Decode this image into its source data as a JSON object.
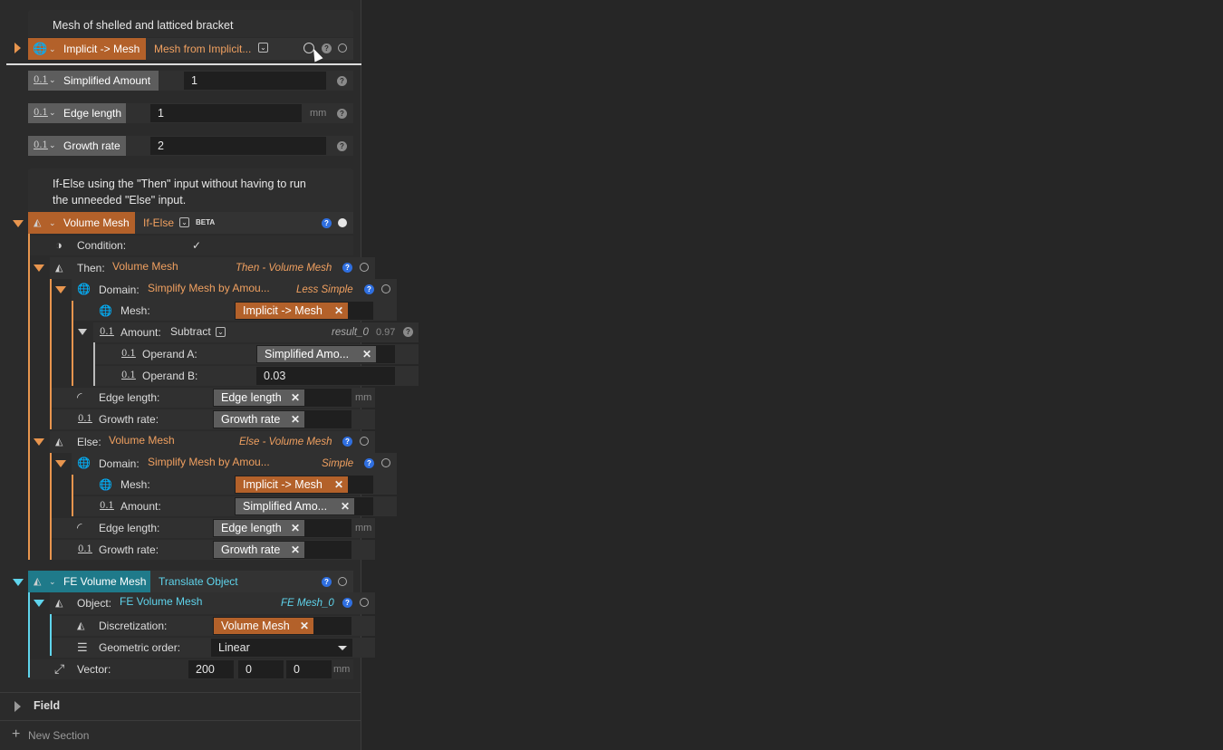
{
  "note1": {
    "text": "Mesh of shelled and latticed bracket"
  },
  "implicit_mesh": {
    "tag": "Implicit -> Mesh",
    "title": "Mesh from Implicit..."
  },
  "simplified_amount": {
    "label": "Simplified Amount",
    "value": "1"
  },
  "edge_length": {
    "label": "Edge length",
    "value": "1",
    "unit": "mm"
  },
  "growth_rate": {
    "label": "Growth rate",
    "value": "2"
  },
  "note2": {
    "line1": "If-Else using the \"Then\" input without having to run",
    "line2": "the unneeded \"Else\" input."
  },
  "volume_mesh": {
    "tag": "Volume Mesh",
    "title": "If-Else",
    "beta": "BETA",
    "condition_label": "Condition:",
    "condition_check": "✓",
    "then": {
      "label": "Then:",
      "title": "Volume Mesh",
      "subtitle": "Then - Volume Mesh",
      "domain_label": "Domain:",
      "domain_title": "Simplify Mesh by Amou...",
      "domain_sub": "Less Simple",
      "mesh_label": "Mesh:",
      "mesh_chip": "Implicit -> Mesh",
      "amount_label": "Amount:",
      "amount_op": "Subtract",
      "amount_result": "result_0",
      "amount_value": "0.97",
      "opA_label": "Operand A:",
      "opA_chip": "Simplified Amo...",
      "opB_label": "Operand B:",
      "opB_value": "0.03",
      "edge_label": "Edge length:",
      "edge_chip": "Edge length",
      "edge_unit": "mm",
      "growth_label": "Growth rate:",
      "growth_chip": "Growth rate"
    },
    "else": {
      "label": "Else:",
      "title": "Volume Mesh",
      "subtitle": "Else - Volume Mesh",
      "domain_label": "Domain:",
      "domain_title": "Simplify Mesh by Amou...",
      "domain_sub": "Simple",
      "mesh_label": "Mesh:",
      "mesh_chip": "Implicit -> Mesh",
      "amount_label": "Amount:",
      "amount_chip": "Simplified Amo...",
      "edge_label": "Edge length:",
      "edge_chip": "Edge length",
      "edge_unit": "mm",
      "growth_label": "Growth rate:",
      "growth_chip": "Growth rate"
    }
  },
  "fe_volume_mesh": {
    "tag": "FE Volume Mesh",
    "title": "Translate Object",
    "object_label": "Object:",
    "object_title": "FE Volume Mesh",
    "object_sub": "FE Mesh_0",
    "disc_label": "Discretization:",
    "disc_chip": "Volume Mesh",
    "order_label": "Geometric order:",
    "order_value": "Linear",
    "vector_label": "Vector:",
    "vec_x": "200",
    "vec_y": "0",
    "vec_z": "0",
    "vec_unit": "mm"
  },
  "field_section": {
    "label": "Field"
  },
  "new_section": {
    "label": "New Section"
  },
  "icons": [
    "globe-icon",
    "tetrahedron-icon",
    "number-01-icon",
    "contrast-icon",
    "arc-icon",
    "list-icon",
    "arrow-diagonal-icon",
    "chevron-down-icon",
    "help-icon",
    "refresh-icon",
    "cursor-icon",
    "plus-icon"
  ],
  "colors": {
    "orange": "#b3612a",
    "orange_text": "#f0a060",
    "teal": "#1f7a8a",
    "teal_text": "#5fd4ec",
    "help_blue": "#2f6fe0"
  }
}
